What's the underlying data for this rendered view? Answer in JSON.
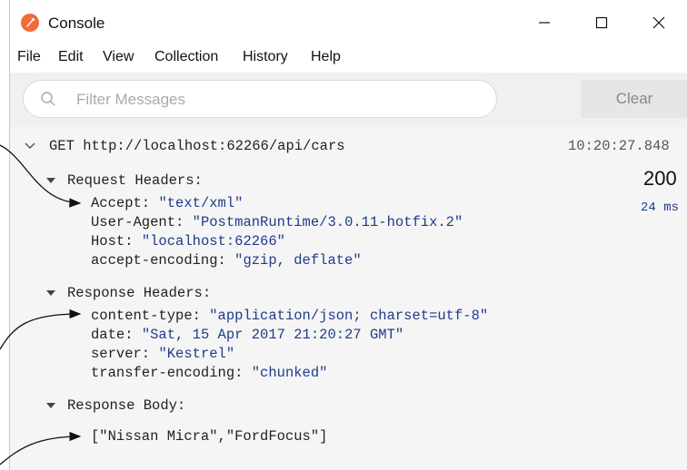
{
  "window": {
    "title": "Console",
    "icon": "postman-rocket-icon",
    "controls": {
      "minimize": "minimize-icon",
      "maximize": "maximize-icon",
      "close": "close-icon"
    }
  },
  "menu": {
    "file": "File",
    "edit": "Edit",
    "view": "View",
    "collection": "Collection",
    "history": "History",
    "help": "Help"
  },
  "toolbar": {
    "search_placeholder": "Filter Messages",
    "clear_label": "Clear"
  },
  "request": {
    "method": "GET",
    "url": "http://localhost:62266/api/cars",
    "timestamp": "10:20:27.848",
    "status": "200",
    "duration": "24 ms",
    "request_headers": {
      "label": "Request Headers:",
      "items": [
        {
          "key": "Accept:",
          "value": "\"text/xml\""
        },
        {
          "key": "User-Agent:",
          "value": "\"PostmanRuntime/3.0.11-hotfix.2\""
        },
        {
          "key": "Host:",
          "value": "\"localhost:62266\""
        },
        {
          "key": "accept-encoding:",
          "value": "\"gzip, deflate\""
        }
      ]
    },
    "response_headers": {
      "label": "Response Headers:",
      "items": [
        {
          "key": "content-type:",
          "value": "\"application/json; charset=utf-8\""
        },
        {
          "key": "date:",
          "value": "\"Sat, 15 Apr 2017 21:20:27 GMT\""
        },
        {
          "key": "server:",
          "value": "\"Kestrel\""
        },
        {
          "key": "transfer-encoding:",
          "value": "\"chunked\""
        }
      ]
    },
    "response_body": {
      "label": "Response Body:",
      "value": "[\"Nissan Micra\",\"FordFocus\"]"
    }
  },
  "colors": {
    "accent": "#f26b3a",
    "value_text": "#1e3c8c",
    "log_background": "#f5f5f5",
    "toolbar_background": "#f0f0f0"
  }
}
